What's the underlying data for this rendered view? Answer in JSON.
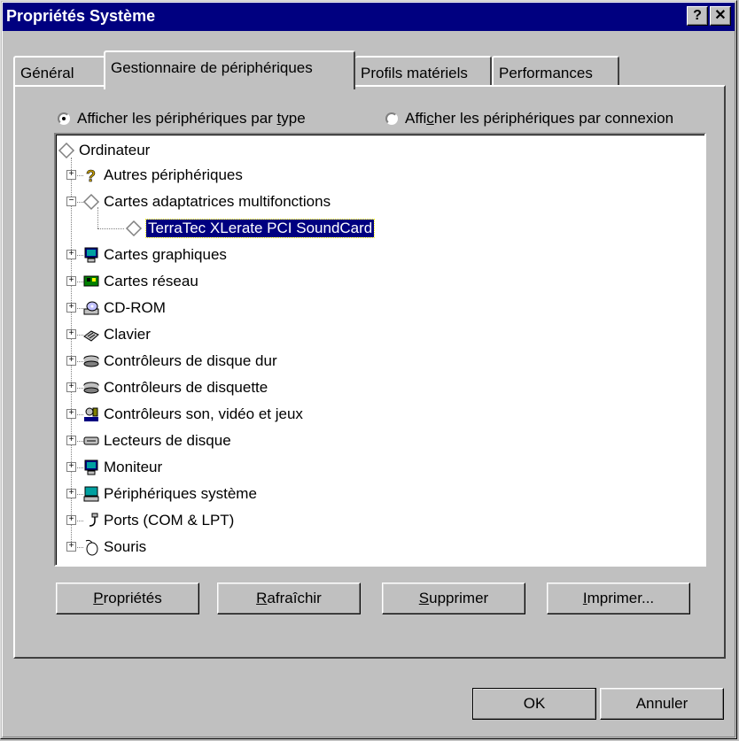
{
  "window": {
    "title": "Propriétés Système",
    "help_label": "?",
    "close_label": "✕"
  },
  "tabs": [
    {
      "label": "Général"
    },
    {
      "label": "Gestionnaire de périphériques"
    },
    {
      "label": "Profils matériels"
    },
    {
      "label": "Performances"
    }
  ],
  "view": {
    "by_type_pre": "Afficher les périphériques par ",
    "by_type_acc": "t",
    "by_type_post": "ype",
    "by_conn_pre": "Affi",
    "by_conn_acc": "c",
    "by_conn_post": "her les périphériques par connexion",
    "selected": "by_type"
  },
  "tree": {
    "root": "Ordinateur",
    "items": [
      {
        "label": "Autres périphériques",
        "icon": "question-icon"
      },
      {
        "label": "Cartes adaptatrices multifonctions",
        "icon": "diamond-icon"
      },
      {
        "label": "TerraTec XLerate PCI SoundCard",
        "icon": "diamond-icon"
      },
      {
        "label": "Cartes graphiques",
        "icon": "monitor-icon"
      },
      {
        "label": "Cartes réseau",
        "icon": "network-card-icon"
      },
      {
        "label": "CD-ROM",
        "icon": "cdrom-icon"
      },
      {
        "label": "Clavier",
        "icon": "keyboard-icon"
      },
      {
        "label": "Contrôleurs de disque dur",
        "icon": "disk-controller-icon"
      },
      {
        "label": "Contrôleurs de disquette",
        "icon": "disk-controller-icon"
      },
      {
        "label": "Contrôleurs son, vidéo et jeux",
        "icon": "sound-icon"
      },
      {
        "label": "Lecteurs de disque",
        "icon": "drive-icon"
      },
      {
        "label": "Moniteur",
        "icon": "monitor-icon"
      },
      {
        "label": "Périphériques système",
        "icon": "computer-icon"
      },
      {
        "label": "Ports (COM & LPT)",
        "icon": "port-icon"
      },
      {
        "label": "Souris",
        "icon": "mouse-icon"
      }
    ]
  },
  "buttons": {
    "properties_acc": "P",
    "properties_rest": "ropriétés",
    "refresh_acc": "R",
    "refresh_rest": "afraîchir",
    "remove_acc": "S",
    "remove_rest": "upprimer",
    "print_acc": "I",
    "print_rest": "mprimer...",
    "ok": "OK",
    "cancel": "Annuler"
  },
  "colors": {
    "title_bar": "#000080",
    "face": "#c0c0c0",
    "selection": "#000080"
  }
}
